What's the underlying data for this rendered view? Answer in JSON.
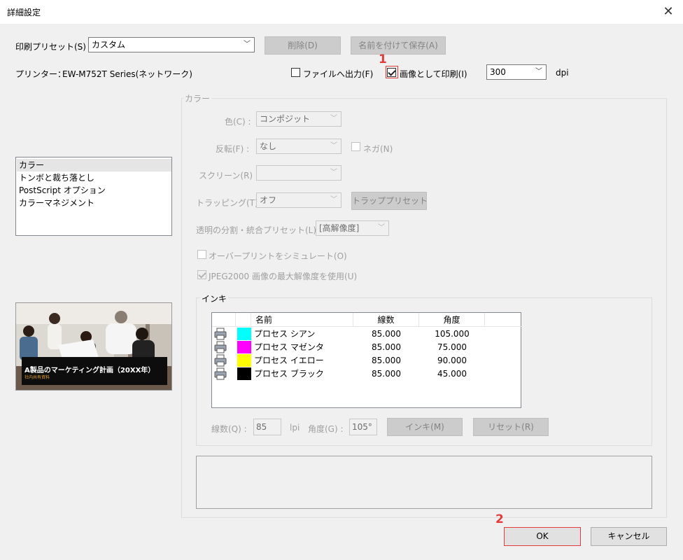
{
  "window": {
    "title": "詳細設定",
    "close_glyph": "✕"
  },
  "preset": {
    "label": "印刷プリセット(S) :",
    "value": "カスタム",
    "delete_button": "削除(D)",
    "save_as_button": "名前を付けて保存(A)"
  },
  "printer": {
    "label": "プリンター：",
    "name": "EW-M752T Series(ネットワーク)",
    "output_to_file": {
      "label": "ファイルへ出力(F)",
      "checked": false
    },
    "print_as_image": {
      "label": "画像として印刷(I)",
      "checked": true
    },
    "dpi_value": "300",
    "dpi_unit": "dpi"
  },
  "category_list": {
    "items": [
      "カラー",
      "トンボと裁ち落とし",
      "PostScript オプション",
      "カラーマネジメント"
    ],
    "selected_index": 0
  },
  "preview": {
    "caption": "A製品のマーケティング計画（20XX年）",
    "subcaption": "社内共有資料"
  },
  "color_group": {
    "title": "カラー",
    "color": {
      "label": "色(C) :",
      "value": "コンポジット"
    },
    "invert": {
      "label": "反転(F) :",
      "value": "なし",
      "negative_label": "ネガ(N)"
    },
    "screen": {
      "label": "スクリーン(R) :",
      "value": ""
    },
    "trapping": {
      "label": "トラッピング(T) :",
      "value": "オフ",
      "preset_button": "トラッププリセット"
    },
    "flattener": {
      "label": "透明の分割・統合プリセット(L) :",
      "value": "[高解像度]"
    },
    "simulate_overprint": {
      "label": "オーバープリントをシミュレート(O)",
      "checked": false
    },
    "jpeg2000": {
      "label": "JPEG2000 画像の最大解像度を使用(U)",
      "checked": true
    }
  },
  "ink_group": {
    "title": "インキ",
    "columns": [
      "名前",
      "線数",
      "角度"
    ],
    "rows": [
      {
        "name": "プロセス シアン",
        "freq": "85.000",
        "angle": "105.000",
        "color": "#00ffff"
      },
      {
        "name": "プロセス マゼンタ",
        "freq": "85.000",
        "angle": "75.000",
        "color": "#ff00ff"
      },
      {
        "name": "プロセス イエロー",
        "freq": "85.000",
        "angle": "90.000",
        "color": "#ffff00"
      },
      {
        "name": "プロセス ブラック",
        "freq": "85.000",
        "angle": "45.000",
        "color": "#000000"
      }
    ],
    "freq_label": "線数(Q) :",
    "freq_value": "85",
    "freq_unit": "lpi",
    "angle_label": "角度(G) :",
    "angle_value": "105°",
    "ink_button": "インキ(M)",
    "reset_button": "リセット(R)"
  },
  "footer": {
    "ok_button": "OK",
    "cancel_button": "キャンセル"
  },
  "annotations": {
    "marker_1": "1",
    "marker_2": "2",
    "highlight_color": "#e23b3b"
  }
}
